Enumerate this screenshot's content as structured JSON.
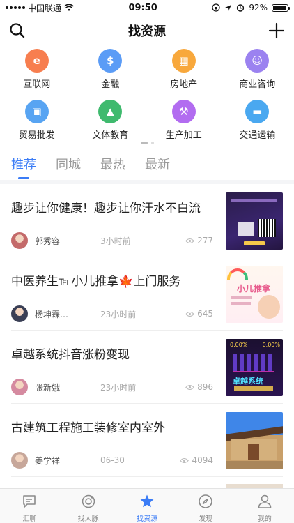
{
  "status_bar": {
    "carrier": "中国联通",
    "time": "09:50",
    "battery": "92%",
    "battery_level": 0.92
  },
  "nav": {
    "title": "找资源",
    "icons": {
      "left": "search-icon",
      "right": "add-icon"
    }
  },
  "categories": [
    {
      "label": "互联网",
      "icon": "internet-icon",
      "color": "#f77e4f",
      "glyph": "e"
    },
    {
      "label": "金融",
      "icon": "finance-icon",
      "color": "#5b9cf6",
      "glyph": "$"
    },
    {
      "label": "房地产",
      "icon": "building-icon",
      "color": "#f8a83c",
      "glyph": "▦"
    },
    {
      "label": "商业咨询",
      "icon": "consulting-icon",
      "color": "#9b82f0",
      "glyph": "☺"
    },
    {
      "label": "贸易批发",
      "icon": "trade-icon",
      "color": "#58a4f2",
      "glyph": "▣"
    },
    {
      "label": "文体教育",
      "icon": "education-icon",
      "color": "#3fba6e",
      "glyph": "▲"
    },
    {
      "label": "生产加工",
      "icon": "manufacturing-icon",
      "color": "#b26cf0",
      "glyph": "⚒"
    },
    {
      "label": "交通运输",
      "icon": "transport-icon",
      "color": "#4aa8f0",
      "glyph": "▬"
    }
  ],
  "tabs": [
    {
      "label": "推荐",
      "active": true
    },
    {
      "label": "同城",
      "active": false
    },
    {
      "label": "最热",
      "active": false
    },
    {
      "label": "最新",
      "active": false
    }
  ],
  "feed": [
    {
      "title": "趣步让你健康！趣步让你汗水不白流",
      "author": "郭秀容",
      "time": "3小时前",
      "views": "277",
      "thumb": "qubu-poster"
    },
    {
      "title": "中医养生℡小儿推拿🍁上门服务",
      "author": "杨坤霖…",
      "time": "23小时前",
      "views": "645",
      "thumb": "xiaoer-tuina-poster",
      "thumb_text": "小儿推拿"
    },
    {
      "title": "卓越系统抖音涨粉变现",
      "author": "张新娥",
      "time": "23小时前",
      "views": "896",
      "thumb": "zhuoyue-poster",
      "thumb_text": "卓越系统",
      "thumb_sub": "0.00%"
    },
    {
      "title": "古建筑工程施工装修室内室外",
      "author": "姜学祥",
      "time": "06-30",
      "views": "4094",
      "thumb": "ancient-building-photo"
    }
  ],
  "tabbar": [
    {
      "label": "汇聊",
      "icon": "chat-icon",
      "active": false
    },
    {
      "label": "找人脉",
      "icon": "network-icon",
      "active": false
    },
    {
      "label": "找资源",
      "icon": "star-icon",
      "active": true
    },
    {
      "label": "发现",
      "icon": "compass-icon",
      "active": false
    },
    {
      "label": "我的",
      "icon": "person-icon",
      "active": false
    }
  ],
  "colors": {
    "accent": "#3b7cf6"
  }
}
